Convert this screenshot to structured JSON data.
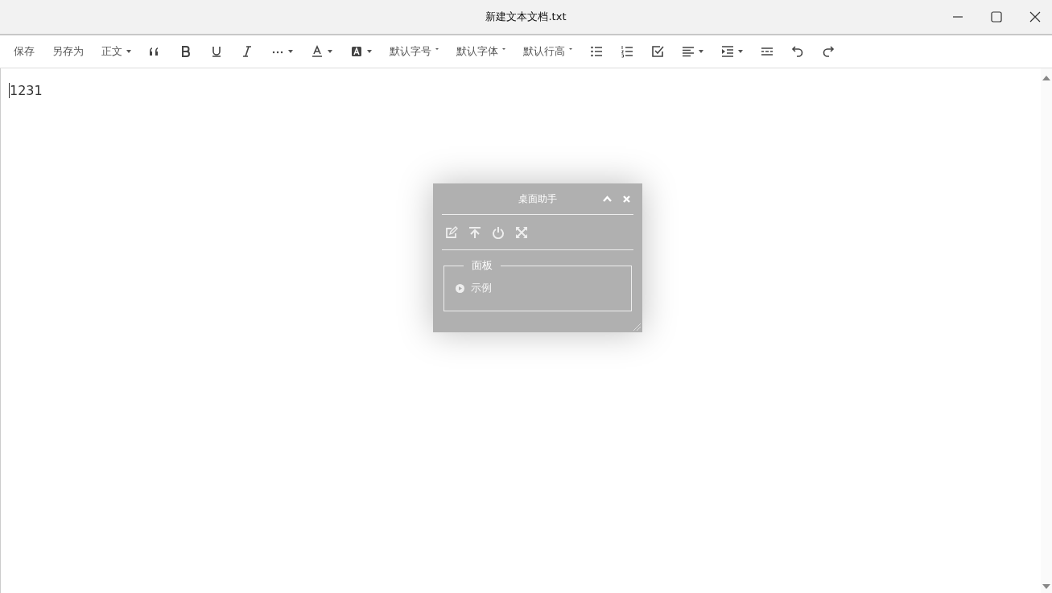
{
  "window": {
    "title": "新建文本文档.txt"
  },
  "toolbar": [
    {
      "kind": "text",
      "label": "保存"
    },
    {
      "kind": "text",
      "label": "另存为"
    },
    {
      "kind": "menu",
      "label": "正文"
    },
    {
      "kind": "quote"
    },
    {
      "kind": "bold"
    },
    {
      "kind": "underline"
    },
    {
      "kind": "italic"
    },
    {
      "kind": "more"
    },
    {
      "kind": "font-color"
    },
    {
      "kind": "highlight"
    },
    {
      "kind": "select",
      "label": "默认字号"
    },
    {
      "kind": "select",
      "label": "默认字体"
    },
    {
      "kind": "select",
      "label": "默认行高"
    },
    {
      "kind": "bullet-list"
    },
    {
      "kind": "numbered-list"
    },
    {
      "kind": "checklist"
    },
    {
      "kind": "align"
    },
    {
      "kind": "indent"
    },
    {
      "kind": "divider"
    },
    {
      "kind": "undo"
    },
    {
      "kind": "redo"
    }
  ],
  "editor": {
    "text": "1231"
  },
  "helper": {
    "title": "桌面助手",
    "tools": [
      {
        "kind": "edit"
      },
      {
        "kind": "pin-top"
      },
      {
        "kind": "power"
      },
      {
        "kind": "fullscreen"
      }
    ],
    "panel": {
      "legend": "面板",
      "items": [
        {
          "label": "示例"
        }
      ]
    }
  }
}
